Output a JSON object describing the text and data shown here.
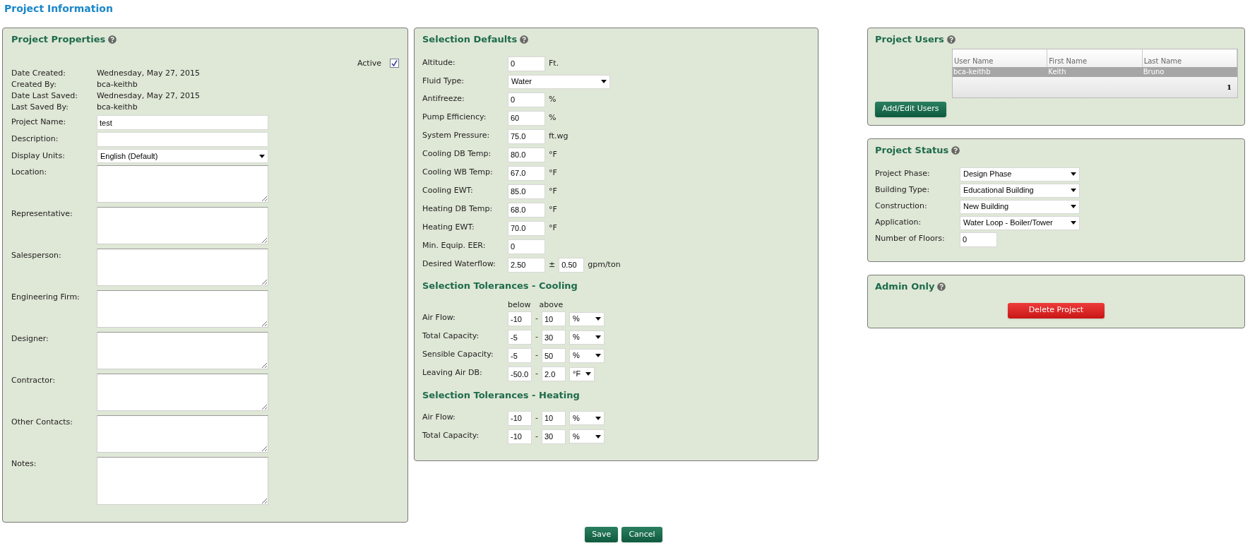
{
  "page_title": "Project Information",
  "project_properties": {
    "title": "Project Properties",
    "active": {
      "label": "Active",
      "checked": true
    },
    "info": [
      {
        "label": "Date Created:",
        "value": "Wednesday, May 27, 2015"
      },
      {
        "label": "Created By:",
        "value": "bca-keithb"
      },
      {
        "label": "Date Last Saved:",
        "value": "Wednesday, May 27, 2015"
      },
      {
        "label": "Last Saved By:",
        "value": "bca-keithb"
      }
    ],
    "fields": [
      {
        "label": "Project Name:",
        "kind": "text",
        "value": "test"
      },
      {
        "label": "Description:",
        "kind": "text"
      },
      {
        "label": "Display Units:",
        "kind": "select",
        "value": "English (Default)"
      },
      {
        "label": "Location:",
        "kind": "textarea"
      },
      {
        "label": "Representative:",
        "kind": "textarea"
      },
      {
        "label": "Salesperson:",
        "kind": "textarea"
      },
      {
        "label": "Engineering Firm:",
        "kind": "textarea"
      },
      {
        "label": "Designer:",
        "kind": "textarea"
      },
      {
        "label": "Contractor:",
        "kind": "textarea"
      },
      {
        "label": "Other Contacts:",
        "kind": "textarea"
      },
      {
        "label": "Notes:",
        "kind": "textarea",
        "tall": true
      }
    ]
  },
  "selection_defaults": {
    "title": "Selection Defaults",
    "fields": [
      {
        "label": "Altitude:",
        "kind": "input",
        "value": "0",
        "unit": "Ft."
      },
      {
        "label": "Fluid Type:",
        "kind": "select",
        "value": "Water"
      },
      {
        "label": "Antifreeze:",
        "kind": "input",
        "value": "0",
        "unit": "%"
      },
      {
        "label": "Pump Efficiency:",
        "kind": "input",
        "value": "60",
        "unit": "%"
      },
      {
        "label": "System Pressure:",
        "kind": "input",
        "value": "75.0",
        "unit": "ft.wg"
      },
      {
        "label": "Cooling DB Temp:",
        "kind": "input",
        "value": "80.0",
        "unit": "°F"
      },
      {
        "label": "Cooling WB Temp:",
        "kind": "input",
        "value": "67.0",
        "unit": "°F"
      },
      {
        "label": "Cooling EWT:",
        "kind": "input",
        "value": "85.0",
        "unit": "°F"
      },
      {
        "label": "Heating DB Temp:",
        "kind": "input",
        "value": "68.0",
        "unit": "°F"
      },
      {
        "label": "Heating EWT:",
        "kind": "input",
        "value": "70.0",
        "unit": "°F"
      },
      {
        "label": "Min. Equip. EER:",
        "kind": "input",
        "value": "0"
      },
      {
        "label": "Desired Waterflow:",
        "kind": "range",
        "value": "2.50",
        "separator": "±",
        "value2": "0.50",
        "unit": "gpm/ton"
      }
    ]
  },
  "tolerances_cooling": {
    "title": "Selection Tolerances - Cooling",
    "column_labels": [
      "below",
      "above"
    ],
    "rows": [
      {
        "label": "Air Flow:",
        "below": "-10",
        "separator": "-",
        "above": "10",
        "unit": "%"
      },
      {
        "label": "Total Capacity:",
        "below": "-5",
        "separator": "-",
        "above": "30",
        "unit": "%"
      },
      {
        "label": "Sensible Capacity:",
        "below": "-5",
        "separator": "-",
        "above": "50",
        "unit": "%"
      },
      {
        "label": "Leaving Air DB:",
        "below": "-50.0",
        "separator": "-",
        "above": "2.0",
        "unit": "°F"
      }
    ]
  },
  "tolerances_heating": {
    "title": "Selection Tolerances - Heating",
    "rows": [
      {
        "label": "Air Flow:",
        "below": "-10",
        "separator": "-",
        "above": "10",
        "unit": "%"
      },
      {
        "label": "Total Capacity:",
        "below": "-10",
        "separator": "-",
        "above": "30",
        "unit": "%"
      }
    ]
  },
  "project_users": {
    "title": "Project Users",
    "table": {
      "columns": [
        "User Name",
        "First Name",
        "Last Name"
      ],
      "rows": [
        {
          "cells": [
            "bca-keithb",
            "Keith",
            "Bruno"
          ],
          "selected": true
        }
      ],
      "page": "1"
    },
    "button": "Add/Edit Users"
  },
  "project_status": {
    "title": "Project Status",
    "fields": [
      {
        "label": "Project Phase:",
        "kind": "select",
        "value": "Design Phase"
      },
      {
        "label": "Building Type:",
        "kind": "select",
        "value": "Educational Building"
      },
      {
        "label": "Construction:",
        "kind": "select",
        "value": "New Building"
      },
      {
        "label": "Application:",
        "kind": "select",
        "value": "Water Loop - Boiler/Tower"
      },
      {
        "label": "Number of Floors:",
        "kind": "input",
        "value": "0"
      }
    ]
  },
  "admin": {
    "title": "Admin Only",
    "button": "Delete Project"
  },
  "actions": [
    "Save",
    "Cancel"
  ]
}
